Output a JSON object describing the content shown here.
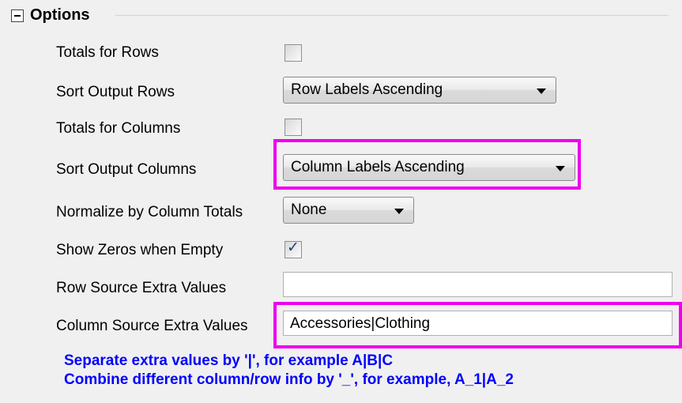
{
  "group": {
    "title": "Options"
  },
  "rows": {
    "totals_rows": {
      "label": "Totals for Rows",
      "checked": false
    },
    "sort_rows": {
      "label": "Sort Output Rows",
      "value": "Row Labels Ascending"
    },
    "totals_columns": {
      "label": "Totals for Columns",
      "checked": false
    },
    "sort_columns": {
      "label": "Sort Output Columns",
      "value": "Column Labels Ascending"
    },
    "normalize": {
      "label": "Normalize by Column Totals",
      "value": "None"
    },
    "show_zeros": {
      "label": "Show Zeros when Empty",
      "checked": true,
      "check_glyph": "✓"
    },
    "row_extra": {
      "label": "Row Source Extra Values",
      "value": ""
    },
    "col_extra": {
      "label": "Column Source Extra Values",
      "value": "Accessories|Clothing"
    }
  },
  "notes": {
    "line1": "Separate extra values by '|', for example A|B|C",
    "line2": "Combine different column/row info by '_', for example, A_1|A_2"
  },
  "colors": {
    "highlight": "#ee00ee",
    "note": "#0000ff",
    "background": "#f0f0f0"
  }
}
